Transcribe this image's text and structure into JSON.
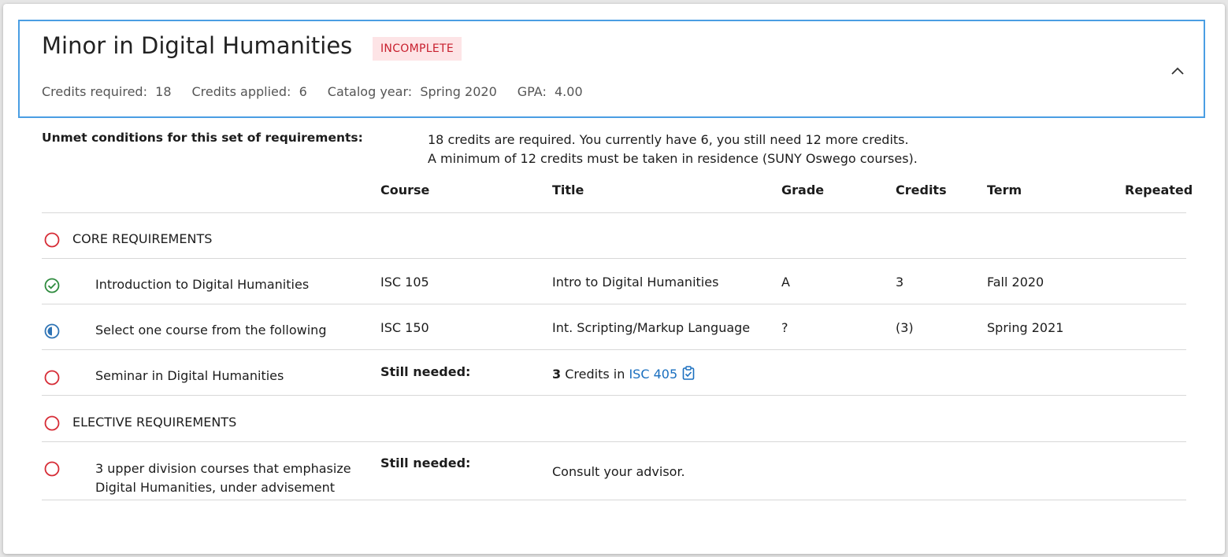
{
  "header": {
    "title": "Minor in Digital Humanities",
    "status_badge": "INCOMPLETE",
    "credits_required_label": "Credits required:",
    "credits_required_value": "18",
    "credits_applied_label": "Credits applied:",
    "credits_applied_value": "6",
    "catalog_year_label": "Catalog year:",
    "catalog_year_value": "Spring 2020",
    "gpa_label": "GPA:",
    "gpa_value": "4.00",
    "collapse_icon": "chevron-up-icon"
  },
  "unmet": {
    "label": "Unmet conditions for this set of requirements:",
    "messages": [
      "18 credits are required. You currently have 6, you still need 12 more credits.",
      "A minimum of 12 credits must be taken in residence (SUNY Oswego courses)."
    ]
  },
  "columns": {
    "course": "Course",
    "title": "Title",
    "grade": "Grade",
    "credits": "Credits",
    "term": "Term",
    "repeated": "Repeated"
  },
  "rows": [
    {
      "type": "group",
      "status": "not-met",
      "label": "CORE REQUIREMENTS"
    },
    {
      "type": "req",
      "status": "complete",
      "label": "Introduction to Digital Humanities",
      "course": "ISC 105",
      "title": "Intro to Digital Humanities",
      "grade": "A",
      "credits": "3",
      "term": "Fall 2020"
    },
    {
      "type": "req",
      "status": "in-progress",
      "label": "Select one course from the following",
      "course": "ISC 150",
      "title": "Int. Scripting/Markup Language",
      "grade": "?",
      "credits": "(3)",
      "term": "Spring 2021"
    },
    {
      "type": "still",
      "status": "not-met",
      "label": "Seminar in Digital Humanities",
      "still_label": "Still needed:",
      "needed_count": "3",
      "needed_text": "Credits in",
      "needed_subject": "ISC",
      "needed_number": "405"
    },
    {
      "type": "group",
      "status": "not-met",
      "label": "ELECTIVE REQUIREMENTS"
    },
    {
      "type": "still",
      "status": "not-met",
      "label_line1": "3 upper division courses that emphasize",
      "label_line2": "Digital Humanities, under advisement",
      "still_label": "Still needed:",
      "note": "Consult your advisor."
    }
  ],
  "colors": {
    "accent_border": "#4a9ee3",
    "badge_bg": "#fde4e6",
    "badge_text": "#c8202e",
    "not_met": "#d62b35",
    "complete": "#2e8b3e",
    "in_progress": "#2f74b5",
    "link": "#1a6fbf"
  }
}
